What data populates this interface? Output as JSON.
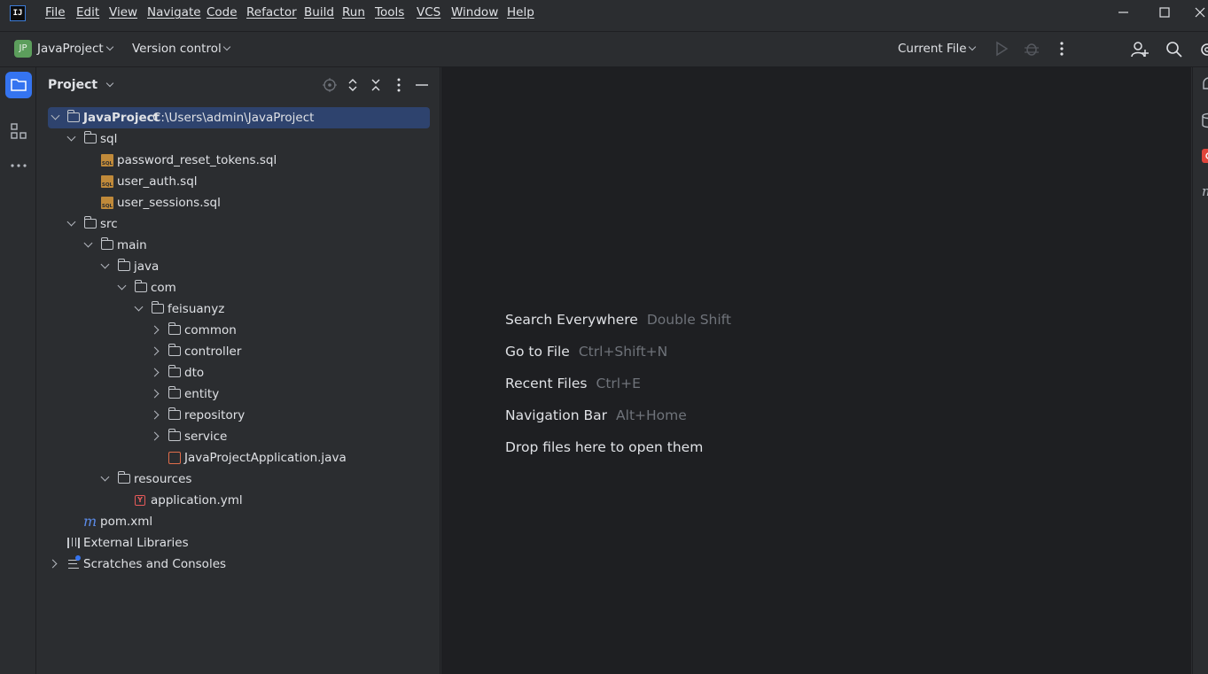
{
  "app": {
    "logo_text": "IJ"
  },
  "menu": [
    {
      "label": "File"
    },
    {
      "label": "Edit"
    },
    {
      "label": "View"
    },
    {
      "label": "Navigate"
    },
    {
      "label": "Code"
    },
    {
      "label": "Refactor"
    },
    {
      "label": "Build"
    },
    {
      "label": "Run"
    },
    {
      "label": "Tools"
    },
    {
      "label": "VCS"
    },
    {
      "label": "Window"
    },
    {
      "label": "Help"
    }
  ],
  "toolbar": {
    "project_badge": "JP",
    "project_name": "JavaProject",
    "vcs_label": "Version control",
    "run_config": "Current File"
  },
  "project_panel": {
    "title": "Project",
    "tree": [
      {
        "name": "JavaProject",
        "path": "C:\\Users\\admin\\JavaProject"
      },
      {
        "name": "sql"
      },
      {
        "name": "password_reset_tokens.sql"
      },
      {
        "name": "user_auth.sql"
      },
      {
        "name": "user_sessions.sql"
      },
      {
        "name": "src"
      },
      {
        "name": "main"
      },
      {
        "name": "java"
      },
      {
        "name": "com"
      },
      {
        "name": "feisuanyz"
      },
      {
        "name": "common"
      },
      {
        "name": "controller"
      },
      {
        "name": "dto"
      },
      {
        "name": "entity"
      },
      {
        "name": "repository"
      },
      {
        "name": "service"
      },
      {
        "name": "JavaProjectApplication.java"
      },
      {
        "name": "resources"
      },
      {
        "name": "application.yml"
      },
      {
        "name": "pom.xml"
      },
      {
        "name": "External Libraries"
      },
      {
        "name": "Scratches and Consoles"
      }
    ]
  },
  "editor": {
    "hints": [
      {
        "action": "Search Everywhere",
        "shortcut": "Double Shift"
      },
      {
        "action": "Go to File",
        "shortcut": "Ctrl+Shift+N"
      },
      {
        "action": "Recent Files",
        "shortcut": "Ctrl+E"
      },
      {
        "action": "Navigation Bar",
        "shortcut": "Alt+Home"
      },
      {
        "action": "Drop files here to open them",
        "shortcut": ""
      }
    ]
  },
  "colors": {
    "background": "#2b2d30",
    "editor_bg": "#1e1f22",
    "accent": "#3574f0",
    "selection": "#2e436e"
  }
}
